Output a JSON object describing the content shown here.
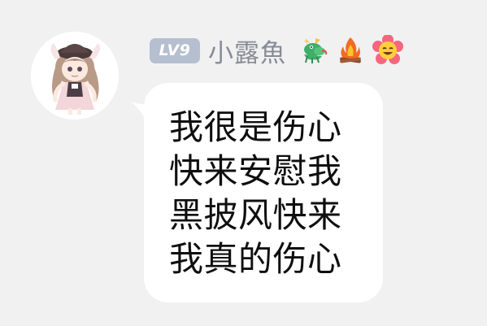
{
  "user": {
    "level_badge": "LV9",
    "username": "小露魚",
    "badge_icons": [
      "dragon-icon",
      "campfire-icon",
      "flower-face-icon"
    ]
  },
  "message": {
    "lines": [
      "我很是伤心",
      "快来安慰我",
      "黑披风快来",
      "我真的伤心"
    ]
  },
  "colors": {
    "background": "#f1f1f2",
    "bubble": "#ffffff",
    "level_badge": "#b6bfd0",
    "username": "#868b96",
    "message_text": "#0f0f10"
  }
}
